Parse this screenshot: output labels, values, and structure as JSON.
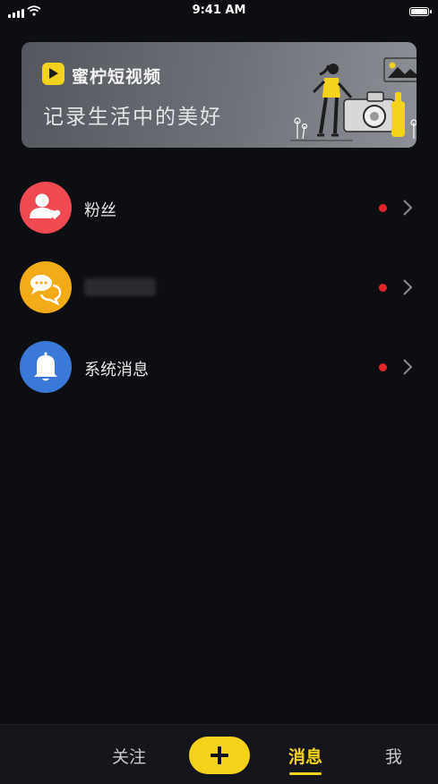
{
  "status_bar": {
    "time": "9:41 AM"
  },
  "banner": {
    "brand_name": "蜜柠短视频",
    "slogan": "记录生活中的美好"
  },
  "messages": [
    {
      "label": "粉丝",
      "icon": "fans-icon",
      "color": "#ef4a52",
      "unread": true
    },
    {
      "label": "",
      "icon": "comment-icon",
      "color": "#f3ab17",
      "unread": true
    },
    {
      "label": "系统消息",
      "icon": "bell-icon",
      "color": "#3a79d8",
      "unread": true
    }
  ],
  "tab_bar": {
    "follow": "关注",
    "messages": "消息",
    "me": "我",
    "active": "消息"
  },
  "colors": {
    "accent": "#f5d21c",
    "unread_dot": "#e0262b"
  }
}
